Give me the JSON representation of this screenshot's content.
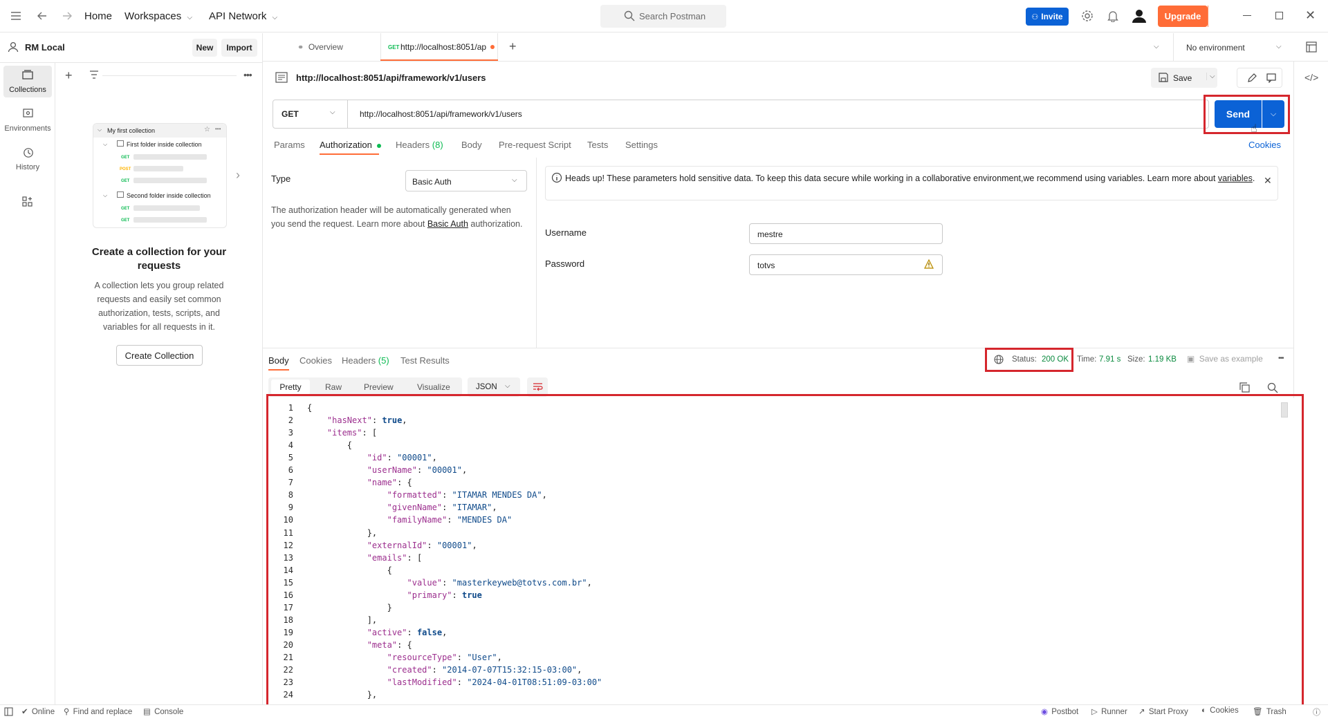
{
  "topbar": {
    "home": "Home",
    "workspaces": "Workspaces",
    "api_network": "API Network",
    "search_placeholder": "Search Postman",
    "invite": "Invite",
    "upgrade": "Upgrade"
  },
  "workspace": {
    "name": "RM Local",
    "new": "New",
    "import": "Import"
  },
  "rail": [
    {
      "label": "Collections"
    },
    {
      "label": "Environments"
    },
    {
      "label": "History"
    }
  ],
  "empty_state": {
    "preview_collection": "My first collection",
    "preview_folder1": "First folder inside collection",
    "preview_folder2": "Second folder inside collection",
    "m_get": "GET",
    "m_post": "POST",
    "title": "Create a collection for your requests",
    "description": "A collection lets you group related requests and easily set common authorization, tests, scripts, and variables for all requests in it.",
    "button": "Create Collection"
  },
  "tabs": {
    "overview": "Overview",
    "request_method": "GET",
    "request_title": "http://localhost:8051/ap",
    "environment": "No environment"
  },
  "request": {
    "name": "http://localhost:8051/api/framework/v1/users",
    "save": "Save",
    "method": "GET",
    "url": "http://localhost:8051/api/framework/v1/users",
    "send": "Send",
    "cookies": "Cookies",
    "subtabs": {
      "params": "Params",
      "authorization": "Authorization",
      "headers": "Headers",
      "headers_count": "(8)",
      "body": "Body",
      "prerequest": "Pre-request Script",
      "tests": "Tests",
      "settings": "Settings"
    }
  },
  "auth": {
    "type_label": "Type",
    "type_value": "Basic Auth",
    "desc_before": "The authorization header will be automatically generated when you send the request. Learn more about ",
    "desc_link": "Basic Auth",
    "desc_after": " authorization.",
    "notice": "Heads up! These parameters hold sensitive data. To keep this data secure while working in a collaborative environment,we recommend using variables. Learn more about ",
    "notice_link": "variables",
    "notice_after": ".",
    "username_label": "Username",
    "username": "mestre",
    "password_label": "Password",
    "password": "totvs"
  },
  "response": {
    "tabs": {
      "body": "Body",
      "cookies": "Cookies",
      "headers": "Headers",
      "headers_count": "(5)",
      "test_results": "Test Results"
    },
    "status_label": "Status:",
    "status_value": "200 OK",
    "time_label": "Time:",
    "time_value": "7.91 s",
    "size_label": "Size:",
    "size_value": "1.19 KB",
    "save_example": "Save as example",
    "views": {
      "pretty": "Pretty",
      "raw": "Raw",
      "preview": "Preview",
      "visualize": "Visualize"
    },
    "format": "JSON"
  },
  "code_lines": [
    "{",
    "    \"hasNext\": true,",
    "    \"items\": [",
    "        {",
    "            \"id\": \"00001\",",
    "            \"userName\": \"00001\",",
    "            \"name\": {",
    "                \"formatted\": \"ITAMAR MENDES DA\",",
    "                \"givenName\": \"ITAMAR\",",
    "                \"familyName\": \"MENDES DA\"",
    "            },",
    "            \"externalId\": \"00001\",",
    "            \"emails\": [",
    "                {",
    "                    \"value\": \"masterkeyweb@totvs.com.br\",",
    "                    \"primary\": true",
    "                }",
    "            ],",
    "            \"active\": false,",
    "            \"meta\": {",
    "                \"resourceType\": \"User\",",
    "                \"created\": \"2014-07-07T15:32:15-03:00\",",
    "                \"lastModified\": \"2024-04-01T08:51:09-03:00\"",
    "            },"
  ],
  "statusbar": {
    "online": "Online",
    "find_replace": "Find and replace",
    "console": "Console",
    "postbot": "Postbot",
    "runner": "Runner",
    "start_proxy": "Start Proxy",
    "cookies": "Cookies",
    "trash": "Trash"
  }
}
